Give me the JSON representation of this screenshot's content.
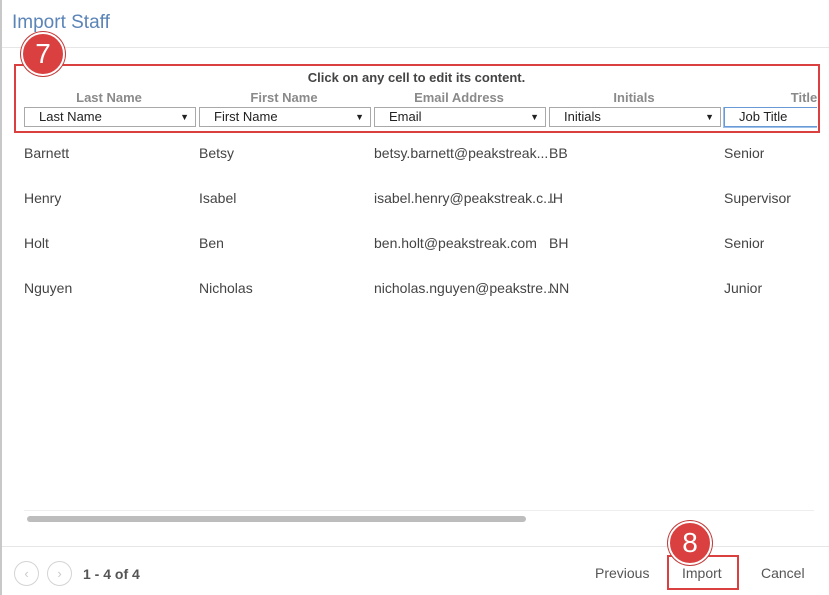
{
  "dialog": {
    "title": "Import Staff"
  },
  "annotations": {
    "step_top": "7",
    "step_bottom": "8",
    "highlight_color": "#d9403f"
  },
  "instruction": "Click on any cell to edit its content.",
  "columns": [
    {
      "header": "Last Name",
      "mapped_field": "Last Name"
    },
    {
      "header": "First Name",
      "mapped_field": "First Name"
    },
    {
      "header": "Email Address",
      "mapped_field": "Email"
    },
    {
      "header": "Initials",
      "mapped_field": "Initials"
    },
    {
      "header": "Title",
      "mapped_field": "Job Title"
    }
  ],
  "rows": [
    [
      "Barnett",
      "Betsy",
      "betsy.barnett@peakstreak...",
      "BB",
      "Senior"
    ],
    [
      "Henry",
      "Isabel",
      "isabel.henry@peakstreak.c...",
      "IH",
      "Supervisor"
    ],
    [
      "Holt",
      "Ben",
      "ben.holt@peakstreak.com",
      "BH",
      "Senior"
    ],
    [
      "Nguyen",
      "Nicholas",
      "nicholas.nguyen@peakstre...",
      "NN",
      "Junior"
    ]
  ],
  "pagination": {
    "prev_icon": "‹",
    "next_icon": "›",
    "range_text": "1 - 4 of 4"
  },
  "footer": {
    "previous_label": "Previous",
    "import_label": "Import",
    "cancel_label": "Cancel"
  },
  "colors": {
    "title": "#5b84b8",
    "accent": "#d9403f"
  }
}
